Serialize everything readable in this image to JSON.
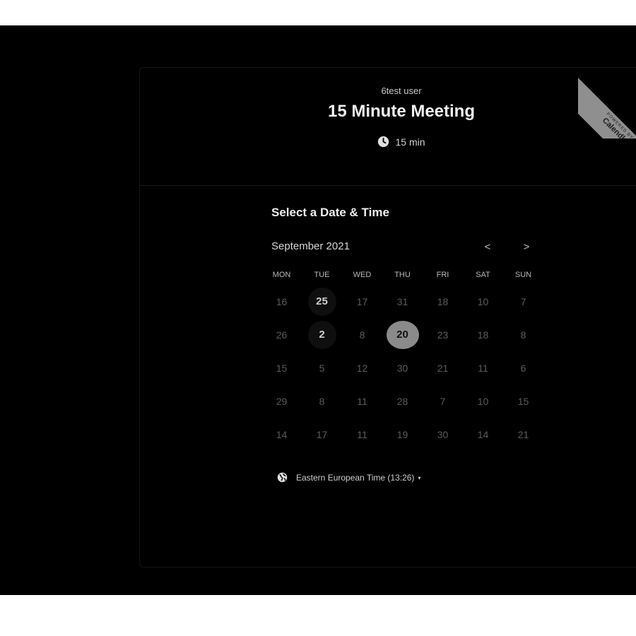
{
  "header": {
    "host_name": "6test user",
    "event_title": "15 Minute Meeting",
    "duration": "15 min"
  },
  "ribbon": {
    "powered": "POWERED BY",
    "brand": "Calendly"
  },
  "scheduler": {
    "section_title": "Select a Date & Time",
    "month": "September 2021",
    "prev_label": "<",
    "next_label": ">",
    "weekdays": [
      "MON",
      "TUE",
      "WED",
      "THU",
      "FRI",
      "SAT",
      "SUN"
    ],
    "weeks": [
      [
        "16",
        "25",
        "17",
        "31",
        "18",
        "10",
        "7"
      ],
      [
        "26",
        "2",
        "8",
        "20",
        "23",
        "18",
        "8"
      ],
      [
        "15",
        "5",
        "12",
        "30",
        "21",
        "11",
        "6"
      ],
      [
        "29",
        "8",
        "11",
        "28",
        "7",
        "10",
        "15"
      ],
      [
        "14",
        "17",
        "11",
        "19",
        "30",
        "14",
        "21"
      ]
    ],
    "available_days": [
      "0-1",
      "1-1"
    ],
    "selected_day": "1-3"
  },
  "timezone": {
    "label": "Eastern European Time (13:26)",
    "caret": "▾"
  },
  "colors": {
    "background": "#000000",
    "selected_day_bg": "#8a8a8a",
    "ribbon": "#8f8f8f"
  }
}
